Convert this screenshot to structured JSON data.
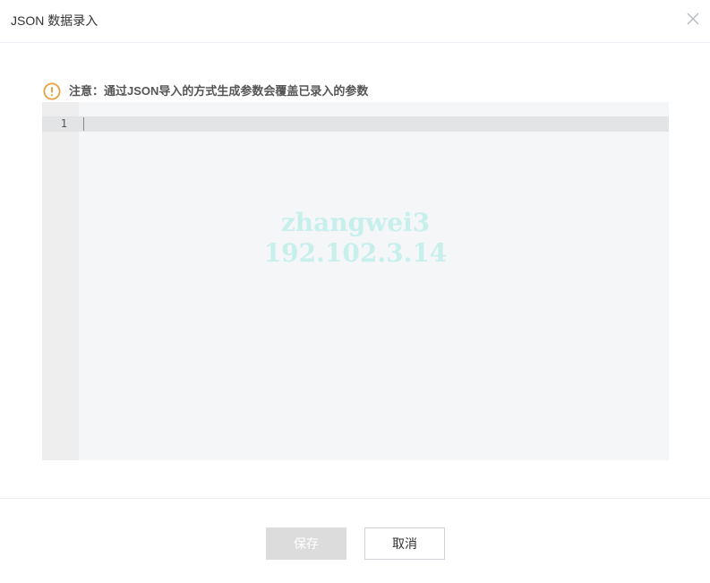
{
  "dialog": {
    "title": "JSON 数据录入",
    "close_icon": "close-icon"
  },
  "notice": {
    "icon": "warning-circle-icon",
    "text": "注意：通过JSON导入的方式生成参数会覆盖已录入的参数",
    "icon_color": "#e6a23c"
  },
  "editor": {
    "lines": [
      {
        "number": "1",
        "content": ""
      }
    ],
    "watermark_user": "zhangwei3",
    "watermark_ip": "192.102.3.14"
  },
  "footer": {
    "save_label": "保存",
    "cancel_label": "取消"
  }
}
